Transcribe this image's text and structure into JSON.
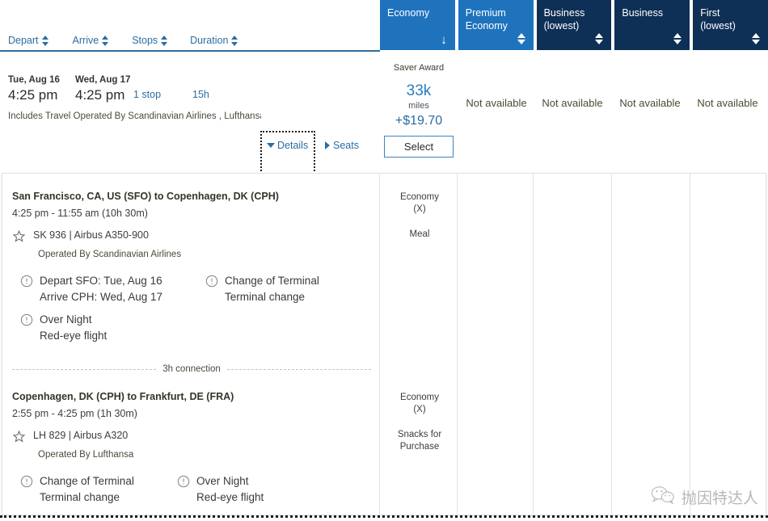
{
  "sort_bar": {
    "items": [
      {
        "label": "Depart",
        "icon": "sort-arrows-icon"
      },
      {
        "label": "Arrive",
        "icon": "sort-arrows-icon"
      },
      {
        "label": "Stops",
        "icon": "sort-arrows-icon"
      },
      {
        "label": "Duration",
        "icon": "sort-arrows-icon"
      }
    ]
  },
  "cabin_tabs": [
    {
      "label": "Economy",
      "selected": true,
      "sort_state": "desc",
      "icon": "arrow-down-icon"
    },
    {
      "label": "Premium\nEconomy",
      "selected": true,
      "sort_state": "none",
      "icon": "sort-arrows-icon"
    },
    {
      "label": "Business\n(lowest)",
      "selected": false,
      "sort_state": "none",
      "icon": "sort-arrows-icon"
    },
    {
      "label": "Business",
      "selected": false,
      "sort_state": "none",
      "icon": "sort-arrows-icon"
    },
    {
      "label": "First\n(lowest)",
      "selected": false,
      "sort_state": "none",
      "icon": "sort-arrows-icon"
    }
  ],
  "colors": {
    "tab_selected": "#1f73bd",
    "tab_dark": "#0e2f56",
    "link_blue": "#2b6ca3",
    "miles_blue": "#2b7cbd",
    "header_rule": "#2c6ca2"
  },
  "summary": {
    "depart_day": "Tue, Aug 16",
    "depart_time": "4:25 pm",
    "arrive_day": "Wed, Aug 17",
    "arrive_time": "4:25 pm",
    "stops": "1 stop",
    "duration": "15h",
    "operated_note": "Includes Travel Operated By Scandinavian Airlines , Lufthansa",
    "details_label": "Details",
    "seats_label": "Seats"
  },
  "price": {
    "award_label": "Saver Award",
    "miles": "33k",
    "miles_unit": "miles",
    "taxes": "+$19.70",
    "select_label": "Select"
  },
  "unavailable": [
    "Not available",
    "Not available",
    "Not available",
    "Not available"
  ],
  "segments": [
    {
      "route": "San Francisco, CA, US (SFO) to Copenhagen, DK (CPH)",
      "times": "4:25 pm - 11:55 am (10h 30m)",
      "flight": "SK 936 | Airbus A350-900",
      "operator": "Operated By Scandinavian Airlines",
      "notes": [
        {
          "title": "Depart SFO: Tue, Aug 16",
          "sub": "Arrive CPH: Wed, Aug 17",
          "icon": "alert-circle-icon"
        },
        {
          "title": "Change of Terminal",
          "sub": "Terminal change",
          "icon": "alert-circle-icon"
        },
        {
          "title": "Over Night",
          "sub": "Red-eye flight",
          "icon": "alert-circle-icon"
        }
      ],
      "cabin": "Economy",
      "cabin_code": "(X)",
      "service": "Meal"
    },
    {
      "route": "Copenhagen, DK (CPH) to Frankfurt, DE (FRA)",
      "times": "2:55 pm - 4:25 pm (1h 30m)",
      "flight": "LH 829 | Airbus A320",
      "operator": "Operated By Lufthansa",
      "notes": [
        {
          "title": "Change of Terminal",
          "sub": "Terminal change",
          "icon": "alert-circle-icon"
        },
        {
          "title": "Over Night",
          "sub": "Red-eye flight",
          "icon": "alert-circle-icon"
        }
      ],
      "cabin": "Economy",
      "cabin_code": "(X)",
      "service_line1": "Snacks for",
      "service_line2": "Purchase"
    }
  ],
  "connection": {
    "label": "3h connection"
  },
  "watermark": {
    "text": "抛因特达人",
    "icon": "wechat-icon"
  }
}
